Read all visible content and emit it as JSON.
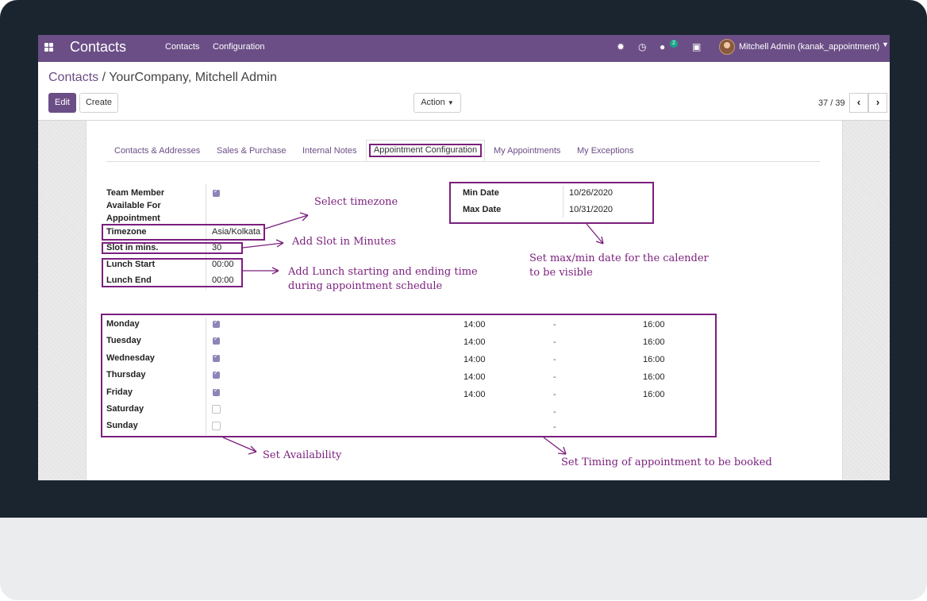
{
  "navbar": {
    "app_title": "Contacts",
    "menu": [
      "Contacts",
      "Configuration"
    ],
    "icons": [
      "apps-grid-icon",
      "bug-icon",
      "clock-icon",
      "chat-icon",
      "gift-icon"
    ],
    "message_count": "2",
    "user": "Mitchell Admin (kanak_appointment)",
    "colors": {
      "bar": "#6b4e86",
      "badge": "#1aa68a"
    }
  },
  "breadcrumb": {
    "parent": "Contacts",
    "separator": "/",
    "current": "YourCompany, Mitchell Admin"
  },
  "toolbar": {
    "edit_label": "Edit",
    "create_label": "Create",
    "action_label": "Action",
    "pager": "37 / 39"
  },
  "tabs": [
    {
      "label": "Contacts & Addresses"
    },
    {
      "label": "Sales & Purchase"
    },
    {
      "label": "Internal Notes"
    },
    {
      "label": "Appointment Configuration",
      "active": true
    },
    {
      "label": "My Appointments"
    },
    {
      "label": "My Exceptions"
    }
  ],
  "config": {
    "team_member_label": [
      "Team Member",
      "Available For",
      "Appointment"
    ],
    "team_member_checked": true,
    "timezone_label": "Timezone",
    "timezone_value": "Asia/Kolkata",
    "slot_label": "Slot in mins.",
    "slot_value": "30",
    "lunch_start_label": "Lunch Start",
    "lunch_start_value": "00:00",
    "lunch_end_label": "Lunch End",
    "lunch_end_value": "00:00",
    "min_date_label": "Min Date",
    "min_date_value": "10/26/2020",
    "max_date_label": "Max Date",
    "max_date_value": "10/31/2020"
  },
  "days": [
    {
      "name": "Monday",
      "checked": true,
      "from": "14:00",
      "sep": "-",
      "to": "16:00"
    },
    {
      "name": "Tuesday",
      "checked": true,
      "from": "14:00",
      "sep": "-",
      "to": "16:00"
    },
    {
      "name": "Wednesday",
      "checked": true,
      "from": "14:00",
      "sep": "-",
      "to": "16:00"
    },
    {
      "name": "Thursday",
      "checked": true,
      "from": "14:00",
      "sep": "-",
      "to": "16:00"
    },
    {
      "name": "Friday",
      "checked": true,
      "from": "14:00",
      "sep": "-",
      "to": "16:00"
    },
    {
      "name": "Saturday",
      "checked": false,
      "from": "",
      "sep": "-",
      "to": ""
    },
    {
      "name": "Sunday",
      "checked": false,
      "from": "",
      "sep": "-",
      "to": ""
    }
  ],
  "annotations": {
    "timezone": "Select timezone",
    "slot": "Add Slot in Minutes",
    "lunch": [
      "Add Lunch starting and ending time",
      "during appointment schedule"
    ],
    "dates": [
      "Set max/min date for the calender",
      "to be visible"
    ],
    "availability": "Set Availability",
    "timing": "Set Timing of appointment to be booked",
    "color": "#7b1f7d"
  }
}
